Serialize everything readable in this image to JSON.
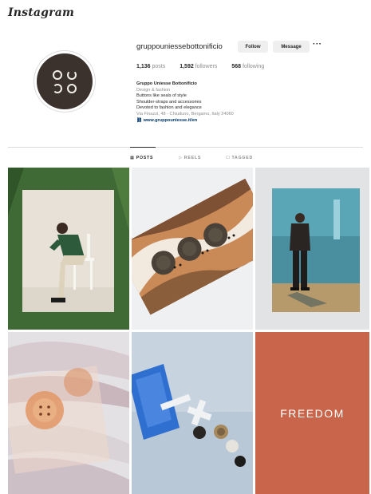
{
  "app": {
    "logo_text": "Instagram"
  },
  "profile": {
    "username": "gruppouniessebottonificio",
    "follow_label": "Follow",
    "message_label": "Message",
    "more_label": "···",
    "stats": {
      "posts_value": "1,136",
      "posts_label": "posts",
      "followers_value": "1,592",
      "followers_label": "followers",
      "following_value": "568",
      "following_label": "following"
    },
    "bio": {
      "name": "Gruppo Uniesse Bottonificio",
      "category": "Design & fashion",
      "line1": "Buttons like seals of style",
      "line2": "Shoulder-straps and accessories",
      "line3": "Devoted to fashion and elegance",
      "address": "Via Finazzi, 48 - Chiuduno, Bergamo, Italy 24060",
      "link": "www.gruppouniesse.it/en"
    }
  },
  "tabs": [
    {
      "label": "POSTS",
      "icon": "grid-icon"
    },
    {
      "label": "REELS",
      "icon": "reels-icon"
    },
    {
      "label": "TAGGED",
      "icon": "tagged-icon"
    }
  ],
  "posts": [
    {
      "icon": "photo-model-chair"
    },
    {
      "icon": "photo-buttons-marble"
    },
    {
      "icon": "photo-man-standing"
    },
    {
      "icon": "photo-buttons-fabric"
    },
    {
      "icon": "photo-buttons-toy"
    },
    {
      "text": "FREEDOM"
    }
  ],
  "colors": {
    "accent_link": "#00376b",
    "muted": "#8e8e8e",
    "freedom_bg": "#c8654a",
    "avatar_bg": "#3b322d"
  }
}
